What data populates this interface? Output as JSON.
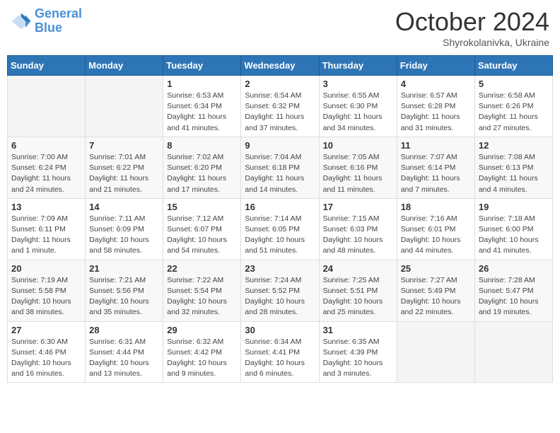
{
  "header": {
    "logo_line1": "General",
    "logo_line2": "Blue",
    "month": "October 2024",
    "location": "Shyrokolanivka, Ukraine"
  },
  "days_of_week": [
    "Sunday",
    "Monday",
    "Tuesday",
    "Wednesday",
    "Thursday",
    "Friday",
    "Saturday"
  ],
  "weeks": [
    [
      null,
      null,
      {
        "day": "1",
        "sunrise": "Sunrise: 6:53 AM",
        "sunset": "Sunset: 6:34 PM",
        "daylight": "Daylight: 11 hours and 41 minutes."
      },
      {
        "day": "2",
        "sunrise": "Sunrise: 6:54 AM",
        "sunset": "Sunset: 6:32 PM",
        "daylight": "Daylight: 11 hours and 37 minutes."
      },
      {
        "day": "3",
        "sunrise": "Sunrise: 6:55 AM",
        "sunset": "Sunset: 6:30 PM",
        "daylight": "Daylight: 11 hours and 34 minutes."
      },
      {
        "day": "4",
        "sunrise": "Sunrise: 6:57 AM",
        "sunset": "Sunset: 6:28 PM",
        "daylight": "Daylight: 11 hours and 31 minutes."
      },
      {
        "day": "5",
        "sunrise": "Sunrise: 6:58 AM",
        "sunset": "Sunset: 6:26 PM",
        "daylight": "Daylight: 11 hours and 27 minutes."
      }
    ],
    [
      {
        "day": "6",
        "sunrise": "Sunrise: 7:00 AM",
        "sunset": "Sunset: 6:24 PM",
        "daylight": "Daylight: 11 hours and 24 minutes."
      },
      {
        "day": "7",
        "sunrise": "Sunrise: 7:01 AM",
        "sunset": "Sunset: 6:22 PM",
        "daylight": "Daylight: 11 hours and 21 minutes."
      },
      {
        "day": "8",
        "sunrise": "Sunrise: 7:02 AM",
        "sunset": "Sunset: 6:20 PM",
        "daylight": "Daylight: 11 hours and 17 minutes."
      },
      {
        "day": "9",
        "sunrise": "Sunrise: 7:04 AM",
        "sunset": "Sunset: 6:18 PM",
        "daylight": "Daylight: 11 hours and 14 minutes."
      },
      {
        "day": "10",
        "sunrise": "Sunrise: 7:05 AM",
        "sunset": "Sunset: 6:16 PM",
        "daylight": "Daylight: 11 hours and 11 minutes."
      },
      {
        "day": "11",
        "sunrise": "Sunrise: 7:07 AM",
        "sunset": "Sunset: 6:14 PM",
        "daylight": "Daylight: 11 hours and 7 minutes."
      },
      {
        "day": "12",
        "sunrise": "Sunrise: 7:08 AM",
        "sunset": "Sunset: 6:13 PM",
        "daylight": "Daylight: 11 hours and 4 minutes."
      }
    ],
    [
      {
        "day": "13",
        "sunrise": "Sunrise: 7:09 AM",
        "sunset": "Sunset: 6:11 PM",
        "daylight": "Daylight: 11 hours and 1 minute."
      },
      {
        "day": "14",
        "sunrise": "Sunrise: 7:11 AM",
        "sunset": "Sunset: 6:09 PM",
        "daylight": "Daylight: 10 hours and 58 minutes."
      },
      {
        "day": "15",
        "sunrise": "Sunrise: 7:12 AM",
        "sunset": "Sunset: 6:07 PM",
        "daylight": "Daylight: 10 hours and 54 minutes."
      },
      {
        "day": "16",
        "sunrise": "Sunrise: 7:14 AM",
        "sunset": "Sunset: 6:05 PM",
        "daylight": "Daylight: 10 hours and 51 minutes."
      },
      {
        "day": "17",
        "sunrise": "Sunrise: 7:15 AM",
        "sunset": "Sunset: 6:03 PM",
        "daylight": "Daylight: 10 hours and 48 minutes."
      },
      {
        "day": "18",
        "sunrise": "Sunrise: 7:16 AM",
        "sunset": "Sunset: 6:01 PM",
        "daylight": "Daylight: 10 hours and 44 minutes."
      },
      {
        "day": "19",
        "sunrise": "Sunrise: 7:18 AM",
        "sunset": "Sunset: 6:00 PM",
        "daylight": "Daylight: 10 hours and 41 minutes."
      }
    ],
    [
      {
        "day": "20",
        "sunrise": "Sunrise: 7:19 AM",
        "sunset": "Sunset: 5:58 PM",
        "daylight": "Daylight: 10 hours and 38 minutes."
      },
      {
        "day": "21",
        "sunrise": "Sunrise: 7:21 AM",
        "sunset": "Sunset: 5:56 PM",
        "daylight": "Daylight: 10 hours and 35 minutes."
      },
      {
        "day": "22",
        "sunrise": "Sunrise: 7:22 AM",
        "sunset": "Sunset: 5:54 PM",
        "daylight": "Daylight: 10 hours and 32 minutes."
      },
      {
        "day": "23",
        "sunrise": "Sunrise: 7:24 AM",
        "sunset": "Sunset: 5:52 PM",
        "daylight": "Daylight: 10 hours and 28 minutes."
      },
      {
        "day": "24",
        "sunrise": "Sunrise: 7:25 AM",
        "sunset": "Sunset: 5:51 PM",
        "daylight": "Daylight: 10 hours and 25 minutes."
      },
      {
        "day": "25",
        "sunrise": "Sunrise: 7:27 AM",
        "sunset": "Sunset: 5:49 PM",
        "daylight": "Daylight: 10 hours and 22 minutes."
      },
      {
        "day": "26",
        "sunrise": "Sunrise: 7:28 AM",
        "sunset": "Sunset: 5:47 PM",
        "daylight": "Daylight: 10 hours and 19 minutes."
      }
    ],
    [
      {
        "day": "27",
        "sunrise": "Sunrise: 6:30 AM",
        "sunset": "Sunset: 4:46 PM",
        "daylight": "Daylight: 10 hours and 16 minutes."
      },
      {
        "day": "28",
        "sunrise": "Sunrise: 6:31 AM",
        "sunset": "Sunset: 4:44 PM",
        "daylight": "Daylight: 10 hours and 13 minutes."
      },
      {
        "day": "29",
        "sunrise": "Sunrise: 6:32 AM",
        "sunset": "Sunset: 4:42 PM",
        "daylight": "Daylight: 10 hours and 9 minutes."
      },
      {
        "day": "30",
        "sunrise": "Sunrise: 6:34 AM",
        "sunset": "Sunset: 4:41 PM",
        "daylight": "Daylight: 10 hours and 6 minutes."
      },
      {
        "day": "31",
        "sunrise": "Sunrise: 6:35 AM",
        "sunset": "Sunset: 4:39 PM",
        "daylight": "Daylight: 10 hours and 3 minutes."
      },
      null,
      null
    ]
  ]
}
